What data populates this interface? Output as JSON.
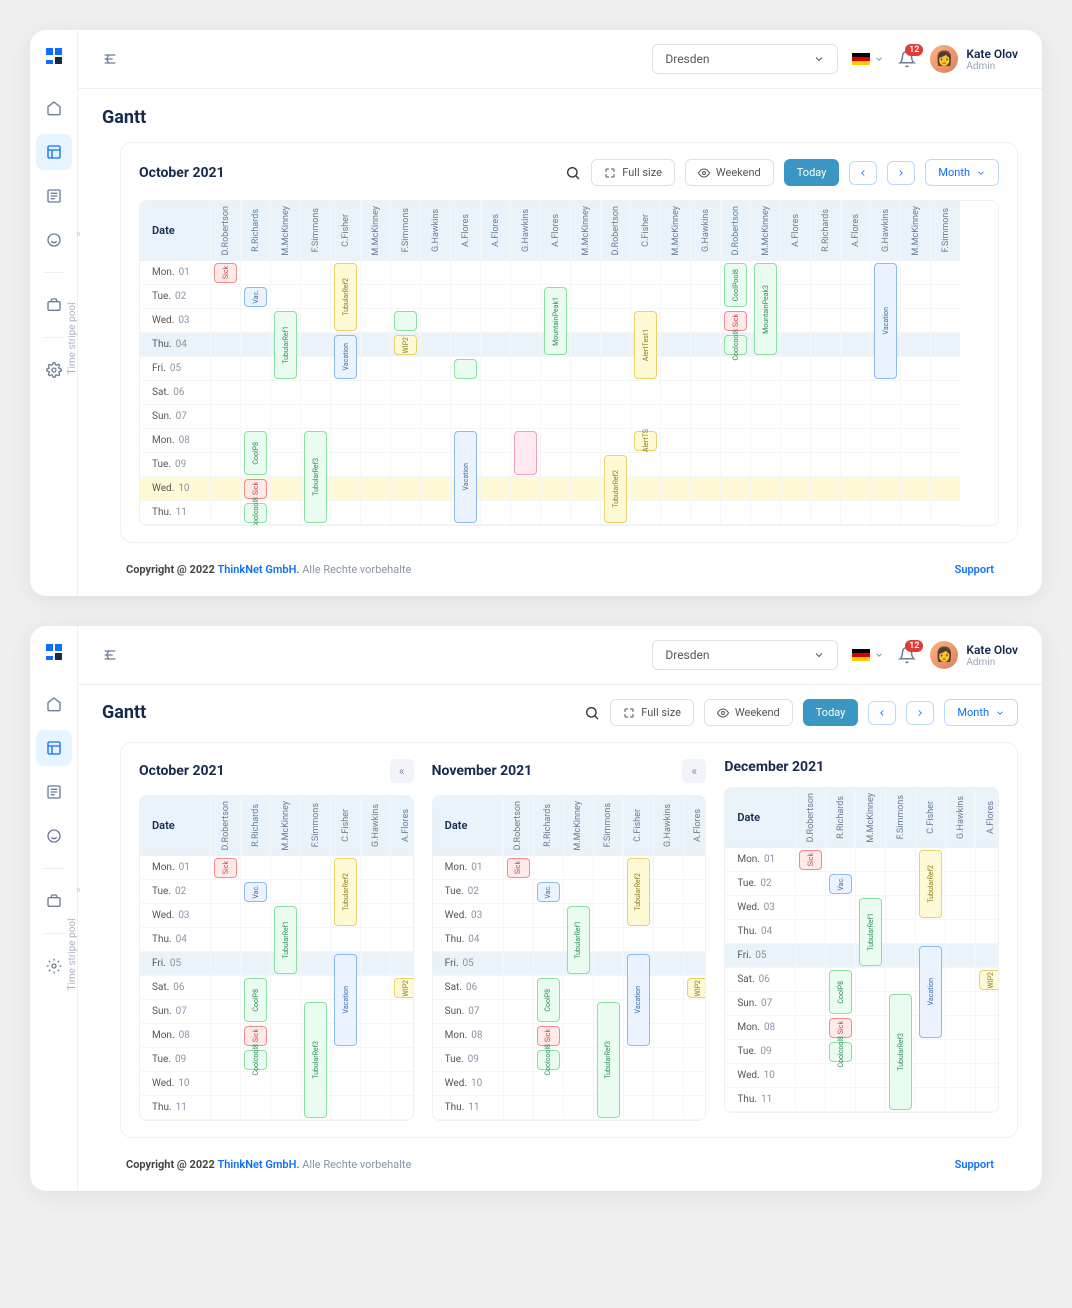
{
  "header": {
    "location": "Dresden",
    "notif_count": "12",
    "user_name": "Kate Olov",
    "user_role": "Admin"
  },
  "page_title": "Gantt",
  "stripe_pool_label": "Time stripe pool",
  "toolbar": {
    "full_size": "Full size",
    "weekend": "Weekend",
    "today": "Today",
    "month": "Month"
  },
  "date_header": "Date",
  "footer": {
    "copyright_prefix": "Copyright @ 2022",
    "company": "ThinkNet GmbH.",
    "rights": "Alle Rechte vorbehalte",
    "support": "Support"
  },
  "people": [
    "D.Robertson",
    "R.Richards",
    "M.McKinney",
    "F.Simmons",
    "C.Fisher",
    "M.McKinney",
    "F.Simmons",
    "G.Hawkins",
    "A.Flores",
    "A.Flores",
    "G.Hawkins",
    "A.Flores",
    "M.McKinney",
    "D.Robertson",
    "C.Fisher",
    "M.McKinney",
    "G.Hawkins",
    "D.Robertson",
    "M.McKinney",
    "A.Flores",
    "R.Richards",
    "A.Flores",
    "G.Hawkins",
    "M.McKinney",
    "F.Simmons"
  ],
  "days_v1": [
    {
      "dow": "Mon.",
      "num": "01"
    },
    {
      "dow": "Tue.",
      "num": "02"
    },
    {
      "dow": "Wed.",
      "num": "03"
    },
    {
      "dow": "Thu.",
      "num": "04",
      "hi": "thu-hi"
    },
    {
      "dow": "Fri.",
      "num": "05"
    },
    {
      "dow": "Sat.",
      "num": "06"
    },
    {
      "dow": "Sun.",
      "num": "07"
    },
    {
      "dow": "Mon.",
      "num": "08"
    },
    {
      "dow": "Tue.",
      "num": "09"
    },
    {
      "dow": "Wed.",
      "num": "10",
      "hi": "wed-hi"
    },
    {
      "dow": "Thu.",
      "num": "11"
    }
  ],
  "tasks_v1": [
    {
      "col": 0,
      "start": 0,
      "span": 1,
      "color": "red",
      "label": "Sick"
    },
    {
      "col": 1,
      "start": 1,
      "span": 1,
      "color": "blue",
      "label": "Vac."
    },
    {
      "col": 2,
      "start": 2,
      "span": 3,
      "color": "green",
      "label": "TubularRef1"
    },
    {
      "col": 4,
      "start": 0,
      "span": 3,
      "color": "yellow",
      "label": "TubularRef2"
    },
    {
      "col": 4,
      "start": 3,
      "span": 2,
      "color": "blue",
      "label": "Vacation"
    },
    {
      "col": 6,
      "start": 2,
      "span": 1,
      "color": "green",
      "label": ""
    },
    {
      "col": 6,
      "start": 3,
      "span": 1,
      "color": "yellow",
      "label": "WIP2"
    },
    {
      "col": 8,
      "start": 4,
      "span": 1,
      "color": "green",
      "label": ""
    },
    {
      "col": 11,
      "start": 1,
      "span": 3,
      "color": "green",
      "label": "MountainPeak1"
    },
    {
      "col": 14,
      "start": 2,
      "span": 3,
      "color": "yellow",
      "label": "AlertTest1"
    },
    {
      "col": 14,
      "start": 7,
      "span": 1,
      "color": "yellow",
      "label": "AlertTS"
    },
    {
      "col": 17,
      "start": 0,
      "span": 2,
      "color": "green",
      "label": "CoolPool8"
    },
    {
      "col": 17,
      "start": 2,
      "span": 1,
      "color": "red",
      "label": "Sick"
    },
    {
      "col": 17,
      "start": 3,
      "span": 1,
      "color": "green",
      "label": "Coolcool8"
    },
    {
      "col": 18,
      "start": 0,
      "span": 4,
      "color": "green",
      "label": "MountainPeak3"
    },
    {
      "col": 22,
      "start": 0,
      "span": 5,
      "color": "blue",
      "label": "Vacation"
    },
    {
      "col": 1,
      "start": 7,
      "span": 2,
      "color": "green",
      "label": "CoolP8"
    },
    {
      "col": 1,
      "start": 9,
      "span": 1,
      "color": "red",
      "label": "Sick"
    },
    {
      "col": 1,
      "start": 10,
      "span": 1,
      "color": "green",
      "label": "Coolcool8"
    },
    {
      "col": 3,
      "start": 7,
      "span": 4,
      "color": "green",
      "label": "TubularRef3"
    },
    {
      "col": 8,
      "start": 7,
      "span": 4,
      "color": "blue",
      "label": "Vacation"
    },
    {
      "col": 10,
      "start": 7,
      "span": 2,
      "color": "pink",
      "label": ""
    },
    {
      "col": 13,
      "start": 8,
      "span": 3,
      "color": "yellow",
      "label": "TubularRef2"
    }
  ],
  "months_v2": [
    "October 2021",
    "November 2021",
    "December 2021"
  ],
  "month_label_v1": "October 2021",
  "people_v2": [
    "D.Robertson",
    "R.Richards",
    "M.McKinney",
    "F.Simmons",
    "C.Fisher",
    "G.Hawkins",
    "A.Flores"
  ],
  "days_v2": [
    {
      "dow": "Mon.",
      "num": "01"
    },
    {
      "dow": "Tue.",
      "num": "02"
    },
    {
      "dow": "Wed.",
      "num": "03"
    },
    {
      "dow": "Thu.",
      "num": "04"
    },
    {
      "dow": "Fri.",
      "num": "05",
      "hi": "thu-hi"
    },
    {
      "dow": "Sat.",
      "num": "06"
    },
    {
      "dow": "Sun.",
      "num": "07"
    },
    {
      "dow": "Mon.",
      "num": "08"
    },
    {
      "dow": "Tue.",
      "num": "09"
    },
    {
      "dow": "Wed.",
      "num": "10"
    },
    {
      "dow": "Thu.",
      "num": "11"
    }
  ],
  "tasks_v2": [
    {
      "col": 0,
      "start": 0,
      "span": 1,
      "color": "red",
      "label": "Sick"
    },
    {
      "col": 1,
      "start": 1,
      "span": 1,
      "color": "blue",
      "label": "Vac."
    },
    {
      "col": 2,
      "start": 2,
      "span": 3,
      "color": "green",
      "label": "TubularRef1"
    },
    {
      "col": 4,
      "start": 0,
      "span": 3,
      "color": "yellow",
      "label": "TubularRef2"
    },
    {
      "col": 4,
      "start": 4,
      "span": 4,
      "color": "blue",
      "label": "Vacation"
    },
    {
      "col": 6,
      "start": 5,
      "span": 1,
      "color": "yellow",
      "label": "WIP2"
    },
    {
      "col": 1,
      "start": 5,
      "span": 2,
      "color": "green",
      "label": "CoolP8"
    },
    {
      "col": 1,
      "start": 7,
      "span": 1,
      "color": "red",
      "label": "Sick"
    },
    {
      "col": 1,
      "start": 8,
      "span": 1,
      "color": "green",
      "label": "Coolcool8"
    },
    {
      "col": 3,
      "start": 6,
      "span": 5,
      "color": "green",
      "label": "TubularRef3"
    }
  ]
}
